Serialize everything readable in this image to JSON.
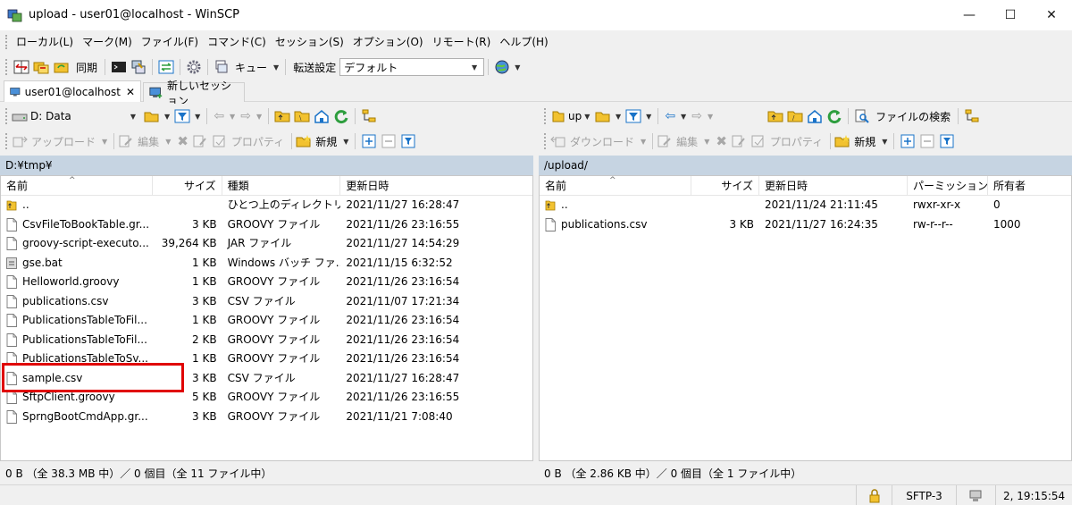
{
  "window": {
    "title": "upload - user01@localhost - WinSCP",
    "minimize": "—",
    "maximize": "☐",
    "close": "✕"
  },
  "menu": [
    "ローカル(L)",
    "マーク(M)",
    "ファイル(F)",
    "コマンド(C)",
    "セッション(S)",
    "オプション(O)",
    "リモート(R)",
    "ヘルプ(H)"
  ],
  "toolbar": {
    "sync_label": "同期",
    "queue_label": "キュー",
    "transfer_label": "転送設定",
    "transfer_value": "デフォルト"
  },
  "tabs": [
    {
      "label": "user01@localhost",
      "close": "✕"
    },
    {
      "label": "新しいセッション"
    }
  ],
  "local": {
    "drive": "D: Data",
    "upload_label": "アップロード",
    "edit_label": "編集",
    "properties_label": "プロパティ",
    "new_label": "新規",
    "path": "D:¥tmp¥",
    "columns": {
      "name": "名前",
      "size": "サイズ",
      "type": "種類",
      "modified": "更新日時"
    },
    "files": [
      {
        "name": "..",
        "size": "",
        "type": "ひとつ上のディレクトリ",
        "modified": "2021/11/27  16:28:47",
        "icon": "parent-dir-icon"
      },
      {
        "name": "CsvFileToBookTable.gr...",
        "size": "3 KB",
        "type": "GROOVY ファイル",
        "modified": "2021/11/26  23:16:55",
        "icon": "file-icon"
      },
      {
        "name": "groovy-script-executo...",
        "size": "39,264 KB",
        "type": "JAR ファイル",
        "modified": "2021/11/27  14:54:29",
        "icon": "file-icon"
      },
      {
        "name": "gse.bat",
        "size": "1 KB",
        "type": "Windows バッチ ファ...",
        "modified": "2021/11/15  6:32:52",
        "icon": "batch-file-icon"
      },
      {
        "name": "Helloworld.groovy",
        "size": "1 KB",
        "type": "GROOVY ファイル",
        "modified": "2021/11/26  23:16:54",
        "icon": "file-icon"
      },
      {
        "name": "publications.csv",
        "size": "3 KB",
        "type": "CSV ファイル",
        "modified": "2021/11/07  17:21:34",
        "icon": "file-icon"
      },
      {
        "name": "PublicationsTableToFil...",
        "size": "1 KB",
        "type": "GROOVY ファイル",
        "modified": "2021/11/26  23:16:54",
        "icon": "file-icon"
      },
      {
        "name": "PublicationsTableToFil...",
        "size": "2 KB",
        "type": "GROOVY ファイル",
        "modified": "2021/11/26  23:16:54",
        "icon": "file-icon"
      },
      {
        "name": "PublicationsTableToSv...",
        "size": "1 KB",
        "type": "GROOVY ファイル",
        "modified": "2021/11/26  23:16:54",
        "icon": "file-icon"
      },
      {
        "name": "sample.csv",
        "size": "3 KB",
        "type": "CSV ファイル",
        "modified": "2021/11/27  16:28:47",
        "icon": "file-icon"
      },
      {
        "name": "SftpClient.groovy",
        "size": "5 KB",
        "type": "GROOVY ファイル",
        "modified": "2021/11/26  23:16:55",
        "icon": "file-icon"
      },
      {
        "name": "SprngBootCmdApp.gr...",
        "size": "3 KB",
        "type": "GROOVY ファイル",
        "modified": "2021/11/21  7:08:40",
        "icon": "file-icon"
      }
    ],
    "status": "0 B （全 38.3 MB 中）／ 0 個目（全 11 ファイル中）"
  },
  "remote": {
    "dir_combo": "up",
    "search_label": "ファイルの検索",
    "download_label": "ダウンロード",
    "edit_label": "編集",
    "properties_label": "プロパティ",
    "new_label": "新規",
    "path": "/upload/",
    "columns": {
      "name": "名前",
      "size": "サイズ",
      "modified": "更新日時",
      "permissions": "パーミッション",
      "owner": "所有者"
    },
    "files": [
      {
        "name": "..",
        "size": "",
        "modified": "2021/11/24 21:11:45",
        "permissions": "rwxr-xr-x",
        "owner": "0",
        "icon": "parent-dir-icon"
      },
      {
        "name": "publications.csv",
        "size": "3 KB",
        "modified": "2021/11/27 16:24:35",
        "permissions": "rw-r--r--",
        "owner": "1000",
        "icon": "file-icon"
      }
    ],
    "status": "0 B （全 2.86 KB 中）／ 0 個目（全 1 ファイル中）"
  },
  "statusbar": {
    "protocol": "SFTP-3",
    "time": "2, 19:15:54"
  },
  "colors": {
    "pathbar": "#c6d4e2",
    "highlight": "#e00000",
    "accent_blue": "#1a73c8",
    "folder_yellow": "#f2c230",
    "green": "#2e9e3e"
  }
}
